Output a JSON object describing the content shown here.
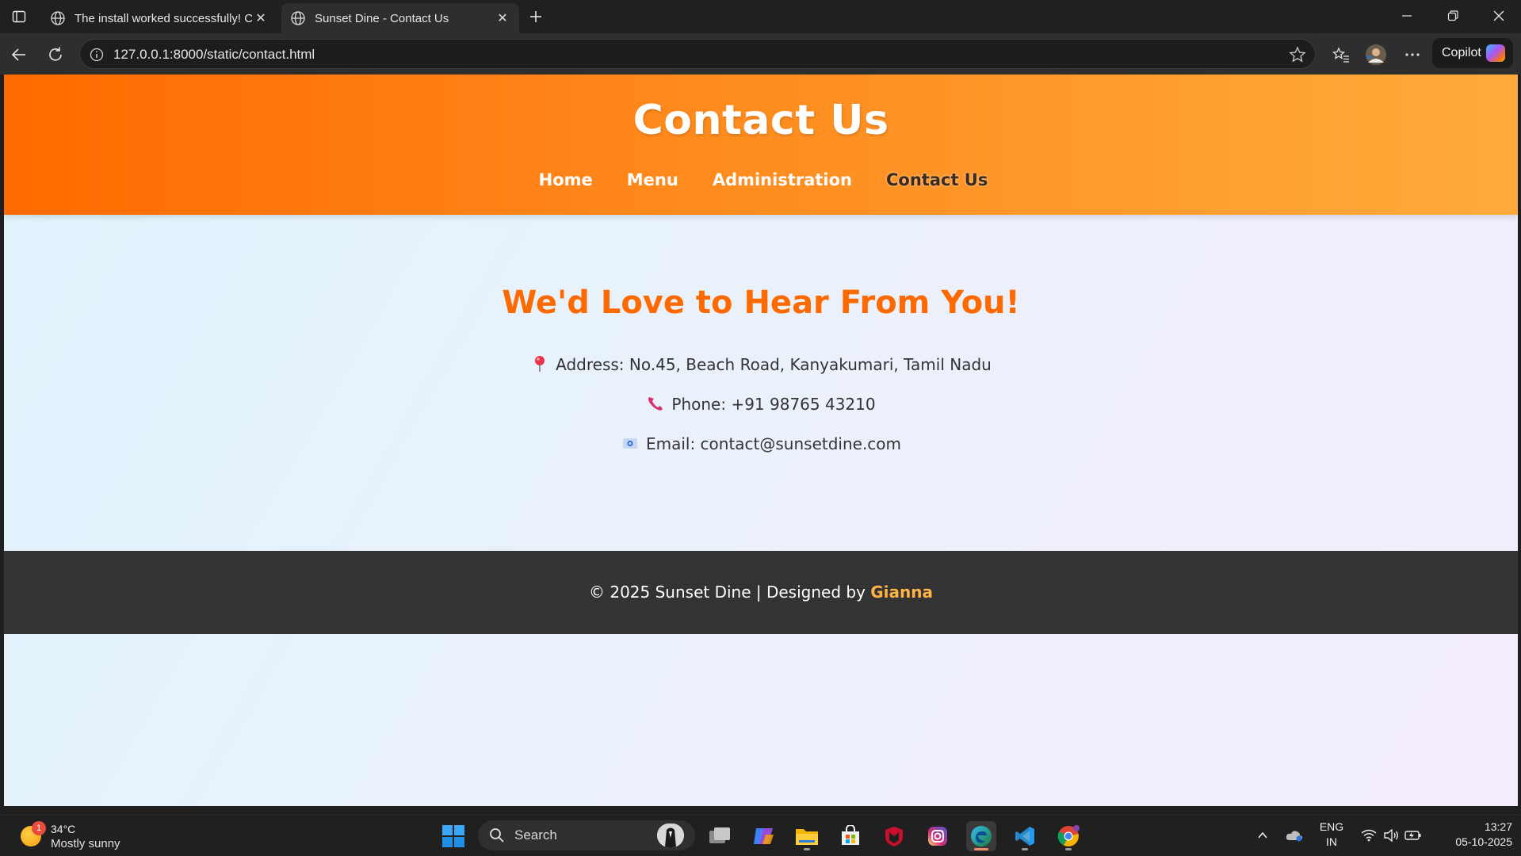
{
  "browser": {
    "tabs": [
      {
        "title": "The install worked successfully! Co",
        "icon": "globe-icon",
        "active": false
      },
      {
        "title": "Sunset Dine - Contact Us",
        "icon": "globe-icon",
        "active": true
      }
    ],
    "address": "127.0.0.1:8000/static/contact.html",
    "copilot_label": "Copilot"
  },
  "site": {
    "title": "Contact Us",
    "nav": [
      {
        "label": "Home"
      },
      {
        "label": "Menu"
      },
      {
        "label": "Administration"
      },
      {
        "label": "Contact Us",
        "current": true
      }
    ],
    "heading": "We'd Love to Hear From You!",
    "contact": {
      "address": "Address: No.45, Beach Road, Kanyakumari, Tamil Nadu",
      "phone": "Phone: +91 98765 43210",
      "email": "Email: contact@sunsetdine.com"
    },
    "footer": {
      "text": "© 2025 Sunset Dine | Designed by ",
      "author": "Gianna"
    },
    "colors": {
      "header_start": "#ff6a00",
      "header_end": "#ffab3c",
      "heading": "#ff6a00",
      "footer_bg": "#333333",
      "footer_author": "#ffb347"
    }
  },
  "taskbar": {
    "weather": {
      "temp": "34°C",
      "condition": "Mostly sunny",
      "badge": "1"
    },
    "search_label": "Search",
    "language": {
      "line1": "ENG",
      "line2": "IN"
    },
    "clock": {
      "time": "13:27",
      "date": "05-10-2025"
    }
  }
}
